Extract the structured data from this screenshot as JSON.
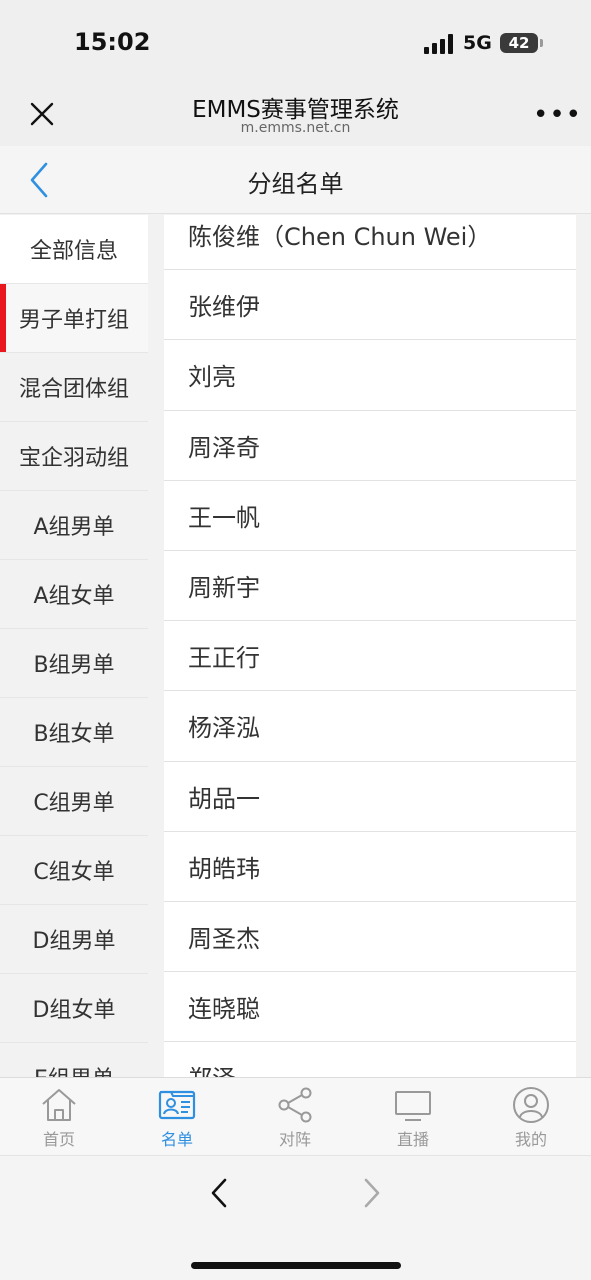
{
  "status": {
    "time": "15:02",
    "network": "5G",
    "battery": "42"
  },
  "browser": {
    "title": "EMMS赛事管理系统",
    "url": "m.emms.net.cn"
  },
  "header": {
    "title": "分组名单"
  },
  "sidebar": {
    "items": [
      {
        "label": "全部信息"
      },
      {
        "label": "男子单打组"
      },
      {
        "label": "混合团体组"
      },
      {
        "label": "宝企羽动组"
      },
      {
        "label": "A组男单"
      },
      {
        "label": "A组女单"
      },
      {
        "label": "B组男单"
      },
      {
        "label": "B组女单"
      },
      {
        "label": "C组男单"
      },
      {
        "label": "C组女单"
      },
      {
        "label": "D组男单"
      },
      {
        "label": "D组女单"
      },
      {
        "label": "E组男单"
      }
    ]
  },
  "list": {
    "names": [
      "陈俊维（Chen Chun Wei）",
      "张维伊",
      "刘亮",
      "周泽奇",
      "王一帆",
      "周新宇",
      "王正行",
      "杨泽泓",
      "胡品一",
      "胡皓玮",
      "周圣杰",
      "连晓聪",
      "郑泽"
    ]
  },
  "tabbar": {
    "items": [
      {
        "label": "首页",
        "icon": "home-icon"
      },
      {
        "label": "名单",
        "icon": "id-card-icon"
      },
      {
        "label": "对阵",
        "icon": "share-icon"
      },
      {
        "label": "直播",
        "icon": "monitor-icon"
      },
      {
        "label": "我的",
        "icon": "user-icon"
      }
    ]
  },
  "colors": {
    "accent": "#2f8fe0",
    "active_marker": "#e8181e"
  }
}
